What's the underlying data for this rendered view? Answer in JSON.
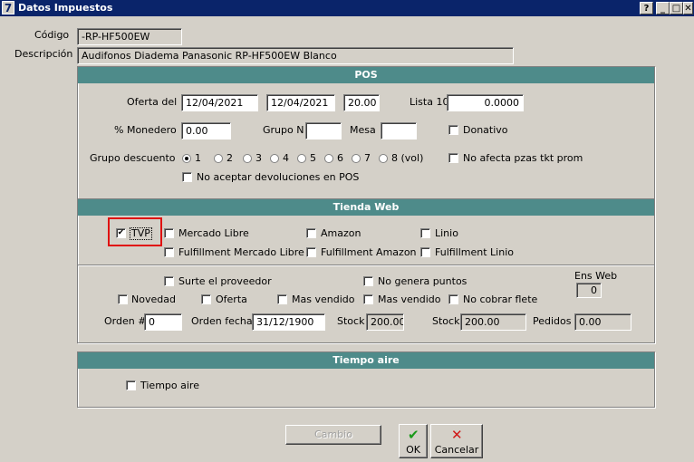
{
  "window": {
    "title": "Datos Impuestos",
    "app_icon": "7",
    "controls": {
      "help": "?",
      "minimize": "_",
      "maximize": "□",
      "close": "✕"
    }
  },
  "header": {
    "codigo_label": "Código",
    "codigo_value": "-RP-HF500EW",
    "descripcion_label": "Descripción",
    "descripcion_value": "Audifonos Diadema Panasonic RP-HF500EW Blanco"
  },
  "pos": {
    "title": "POS",
    "oferta_label": "Oferta del",
    "oferta_from": "12/04/2021",
    "oferta_to": "12/04/2021",
    "oferta_value": "20.00",
    "lista_label": "Lista 10",
    "lista_value": "0.0000",
    "monedero_label": "% Monedero",
    "monedero_value": "0.00",
    "grupo_n_label": "Grupo N",
    "grupo_n_value": "",
    "mesa_label": "Mesa",
    "mesa_value": "",
    "donativo_label": "Donativo",
    "grupo_desc_label": "Grupo  descuento",
    "grupo_options": [
      "1",
      "2",
      "3",
      "4",
      "5",
      "6",
      "7",
      "8 (vol)"
    ],
    "grupo_selected": "1",
    "no_afecta_label": "No afecta pzas tkt prom",
    "no_aceptar_label": "No aceptar devoluciones en POS"
  },
  "web": {
    "title": "Tienda Web",
    "tvp_label": "TVP",
    "mercado_libre_label": "Mercado Libre",
    "amazon_label": "Amazon",
    "linio_label": "Linio",
    "fulfillment_ml_label": "Fulfillment Mercado Libre",
    "fulfillment_amazon_label": "Fulfillment Amazon",
    "fulfillment_linio_label": "Fulfillment Linio",
    "surte_label": "Surte el proveedor",
    "no_genera_label": "No genera puntos",
    "ens_web_label": "Ens Web",
    "ens_web_value": "0",
    "novedad_label": "Novedad",
    "oferta_label": "Oferta",
    "mas_vendido_1_label": "Mas vendido",
    "mas_vendido_2_label": "Mas vendido",
    "no_cobrar_label": "No cobrar flete",
    "orden_label": "Orden #",
    "orden_value": "0",
    "orden_fecha_label": "Orden fecha",
    "orden_fecha_value": "31/12/1900",
    "stock1_label": "Stock",
    "stock1_value": "200.00",
    "stock2_label": "Stock",
    "stock2_value": "200.00",
    "pedidos_label": "Pedidos",
    "pedidos_value": "0.00"
  },
  "tiempo": {
    "title": "Tiempo aire",
    "checkbox_label": "Tiempo aire"
  },
  "buttons": {
    "cambio": "Cambio",
    "ok": "OK",
    "cancelar": "Cancelar",
    "ok_icon": "check-icon",
    "cancel_icon": "x-icon",
    "ok_color": "#1a9a1a",
    "cancel_color": "#d01818"
  },
  "colors": {
    "panel_header": "#4e8b8a",
    "title_bar": "#0a246a",
    "highlight": "#e01010"
  }
}
